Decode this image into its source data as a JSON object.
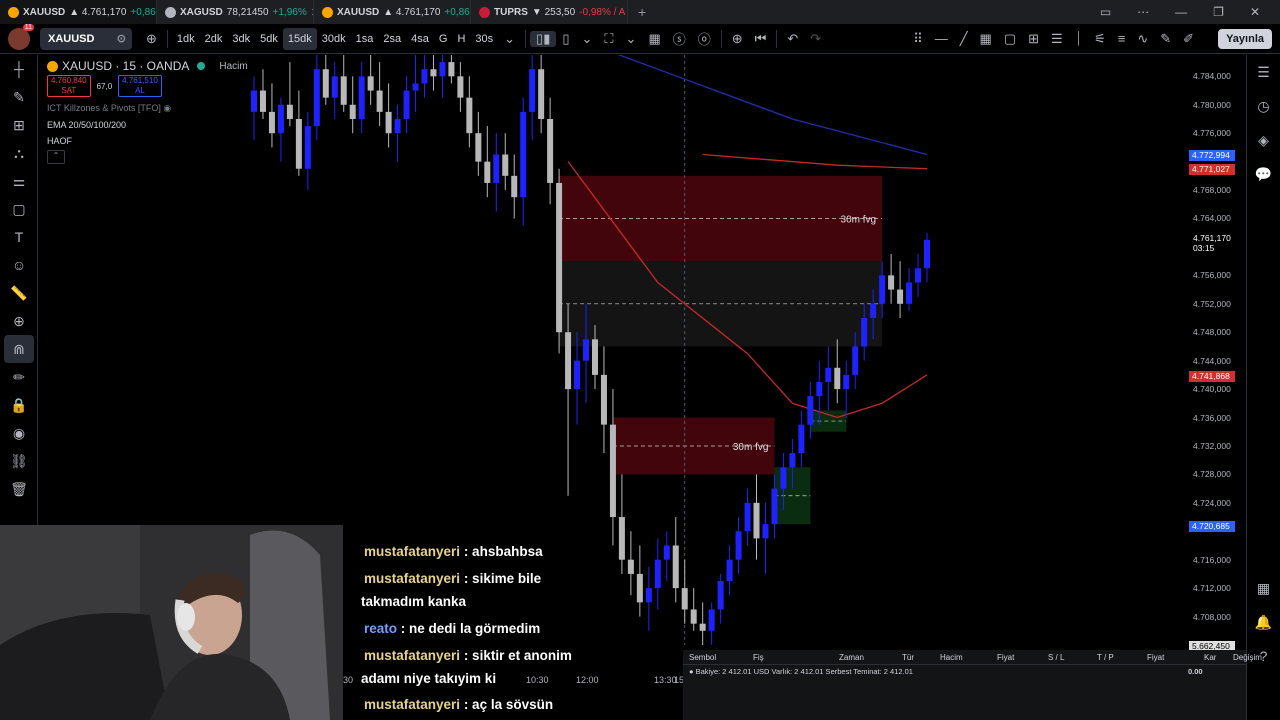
{
  "tabs": [
    {
      "symbol": "XAUUSD",
      "price": "▲ 4.761,170",
      "change": "+0,86%",
      "icon_color": "#f7a600",
      "negative": false,
      "active": true
    },
    {
      "symbol": "XAGUSD",
      "price": "78,21450",
      "change": "+1,96%",
      "icon_color": "#b2b5be",
      "negative": false,
      "active": false
    },
    {
      "symbol": "XAUUSD",
      "price": "▲ 4.761,170",
      "change": "+0,86%",
      "icon_color": "#f7a600",
      "negative": false,
      "active": false
    },
    {
      "symbol": "TUPRS",
      "price": "▼ 253,50",
      "change": "-0,98% / A",
      "icon_color": "#c41e3a",
      "negative": true,
      "active": false
    }
  ],
  "toolbar": {
    "symbol": "XAUUSD",
    "badge": "11",
    "timeframes": [
      "1dk",
      "2dk",
      "3dk",
      "5dk",
      "15dk",
      "30dk",
      "1sa",
      "2sa",
      "4sa",
      "G",
      "H",
      "30s"
    ],
    "selected_timeframe": "15dk",
    "publish_label": "Yayınla"
  },
  "legend": {
    "title": "XAUUSD · 15 · OANDA",
    "volume_label": "Hacim",
    "sell_price": "4.760,840",
    "sell_label": "SAT",
    "spread": "67,0",
    "buy_price": "4.761,510",
    "buy_label": "AL",
    "indicators": [
      "ICT Killzones & Pivots [TFO]",
      "EMA 20/50/100/200",
      "HAOF"
    ]
  },
  "price_axis": {
    "ticks": [
      "4.784,000",
      "4.780,000",
      "4.776,000",
      "4.768,000",
      "4.764,000",
      "4.756,000",
      "4.752,000",
      "4.748,000",
      "4.744,000",
      "4.740,000",
      "4.736,000",
      "4.732,000",
      "4.728,000",
      "4.724,000",
      "4.716,000",
      "4.712,000",
      "4.708,000"
    ],
    "current_price": "4.761,170",
    "countdown": "03:15",
    "tags": [
      {
        "value": "4.772,994",
        "color": "#2962ff"
      },
      {
        "value": "4.771,027",
        "color": "#d32f2f"
      },
      {
        "value": "4.741,868",
        "color": "#d32f2f"
      },
      {
        "value": "4.720,685",
        "color": "#2962ff"
      }
    ],
    "volume_value": "5.662,450"
  },
  "chart_annotations": {
    "fvg_upper": "30m fvg",
    "fvg_lower": "30m fvg"
  },
  "time_axis": [
    "30",
    "10:30",
    "12:00",
    "13:30",
    "15"
  ],
  "panel": {
    "headers": [
      "Sembol",
      "Fiş",
      "Zaman",
      "Tür",
      "Hacim",
      "Fiyat",
      "S / L",
      "T / P",
      "Fiyat",
      "Kar",
      "Değişim"
    ],
    "balance_text": "Bakiye: 2 412.01 USD  Varlık: 2 412.01  Serbest Teminat: 2 412.01",
    "balance_value": "0.00"
  },
  "chat": [
    {
      "user": "mustafatanyeri",
      "text": ": ahsbahbsa"
    },
    {
      "user": "mustafatanyeri",
      "text": ": sikime bile"
    },
    {
      "user": "",
      "text": "takmadım kanka"
    },
    {
      "user": "reato",
      "text": ": ne dedi la görmedim"
    },
    {
      "user": "mustafatanyeri",
      "text": ": siktir et anonim"
    },
    {
      "user": "",
      "text": "adamı niye takıyim ki"
    },
    {
      "user": "mustafatanyeri",
      "text": ": aç la sövsün"
    }
  ],
  "chart_data": {
    "type": "candlestick",
    "title": "XAUUSD · 15 · OANDA",
    "ylim": [
      4704,
      4787
    ],
    "candles": [
      [
        4779,
        4784,
        4775,
        4782
      ],
      [
        4782,
        4785,
        4778,
        4779
      ],
      [
        4779,
        4783,
        4774,
        4776
      ],
      [
        4776,
        4781,
        4772,
        4780
      ],
      [
        4780,
        4786,
        4777,
        4778
      ],
      [
        4778,
        4782,
        4770,
        4771
      ],
      [
        4771,
        4779,
        4768,
        4777
      ],
      [
        4777,
        4787,
        4775,
        4785
      ],
      [
        4785,
        4787,
        4780,
        4781
      ],
      [
        4781,
        4786,
        4778,
        4784
      ],
      [
        4784,
        4787,
        4779,
        4780
      ],
      [
        4780,
        4784,
        4776,
        4778
      ],
      [
        4778,
        4786,
        4776,
        4784
      ],
      [
        4784,
        4787,
        4780,
        4782
      ],
      [
        4782,
        4786,
        4777,
        4779
      ],
      [
        4779,
        4783,
        4774,
        4776
      ],
      [
        4776,
        4780,
        4772,
        4778
      ],
      [
        4778,
        4784,
        4776,
        4782
      ],
      [
        4782,
        4787,
        4779,
        4783
      ],
      [
        4783,
        4787,
        4781,
        4785
      ],
      [
        4785,
        4787,
        4782,
        4784
      ],
      [
        4784,
        4787,
        4781,
        4786
      ],
      [
        4786,
        4787,
        4783,
        4784
      ],
      [
        4784,
        4786,
        4779,
        4781
      ],
      [
        4781,
        4784,
        4774,
        4776
      ],
      [
        4776,
        4779,
        4770,
        4772
      ],
      [
        4772,
        4777,
        4767,
        4769
      ],
      [
        4769,
        4776,
        4765,
        4773
      ],
      [
        4773,
        4776,
        4768,
        4770
      ],
      [
        4770,
        4773,
        4764,
        4767
      ],
      [
        4767,
        4781,
        4763,
        4779
      ],
      [
        4779,
        4787,
        4775,
        4785
      ],
      [
        4785,
        4787,
        4776,
        4778
      ],
      [
        4778,
        4781,
        4766,
        4769
      ],
      [
        4769,
        4771,
        4745,
        4748
      ],
      [
        4748,
        4752,
        4725,
        4740
      ],
      [
        4740,
        4748,
        4735,
        4744
      ],
      [
        4744,
        4752,
        4738,
        4747
      ],
      [
        4747,
        4749,
        4740,
        4742
      ],
      [
        4742,
        4746,
        4731,
        4735
      ],
      [
        4735,
        4740,
        4718,
        4722
      ],
      [
        4722,
        4728,
        4714,
        4716
      ],
      [
        4716,
        4720,
        4711,
        4714
      ],
      [
        4714,
        4718,
        4708,
        4710
      ],
      [
        4710,
        4715,
        4706,
        4712
      ],
      [
        4712,
        4719,
        4709,
        4716
      ],
      [
        4716,
        4720,
        4713,
        4718
      ],
      [
        4718,
        4722,
        4710,
        4712
      ],
      [
        4712,
        4716,
        4707,
        4709
      ],
      [
        4709,
        4712,
        4706,
        4707
      ],
      [
        4707,
        4710,
        4704,
        4706
      ],
      [
        4706,
        4710,
        4704,
        4709
      ],
      [
        4709,
        4714,
        4707,
        4713
      ],
      [
        4713,
        4718,
        4711,
        4716
      ],
      [
        4716,
        4722,
        4714,
        4720
      ],
      [
        4720,
        4726,
        4718,
        4724
      ],
      [
        4724,
        4728,
        4716,
        4719
      ],
      [
        4719,
        4724,
        4714,
        4721
      ],
      [
        4721,
        4728,
        4719,
        4726
      ],
      [
        4726,
        4731,
        4723,
        4729
      ],
      [
        4729,
        4733,
        4726,
        4731
      ],
      [
        4731,
        4737,
        4729,
        4735
      ],
      [
        4735,
        4741,
        4733,
        4739
      ],
      [
        4739,
        4744,
        4735,
        4741
      ],
      [
        4741,
        4746,
        4737,
        4743
      ],
      [
        4743,
        4747,
        4738,
        4740
      ],
      [
        4740,
        4744,
        4736,
        4742
      ],
      [
        4742,
        4748,
        4740,
        4746
      ],
      [
        4746,
        4752,
        4744,
        4750
      ],
      [
        4750,
        4754,
        4747,
        4752
      ],
      [
        4752,
        4758,
        4750,
        4756
      ],
      [
        4756,
        4759,
        4752,
        4754
      ],
      [
        4754,
        4758,
        4750,
        4752
      ],
      [
        4752,
        4757,
        4751,
        4755
      ],
      [
        4755,
        4759,
        4753,
        4757
      ],
      [
        4757,
        4762,
        4755,
        4761
      ]
    ],
    "ema_lines": [
      {
        "name": "EMA 200",
        "color": "#1e2fb0",
        "points": [
          [
            0,
            4795
          ],
          [
            14,
            4793
          ],
          [
            30,
            4792
          ],
          [
            45,
            4785
          ],
          [
            60,
            4778
          ],
          [
            75,
            4773
          ]
        ]
      },
      {
        "name": "EMA 100",
        "color": "#c62828",
        "points": [
          [
            35,
            4772
          ],
          [
            45,
            4755
          ],
          [
            55,
            4745
          ],
          [
            60,
            4738
          ],
          [
            65,
            4736
          ],
          [
            70,
            4738
          ],
          [
            75,
            4742
          ]
        ]
      },
      {
        "name": "EMA 50",
        "color": "#c62828",
        "points": [
          [
            50,
            4773
          ],
          [
            65,
            4771.5
          ],
          [
            75,
            4771
          ]
        ]
      }
    ],
    "zones": [
      {
        "label": "30m fvg",
        "color": "rgba(120,10,20,0.55)",
        "x0": 34,
        "x1": 70,
        "y0": 4770,
        "y1": 4758
      },
      {
        "label": "",
        "color": "rgba(255,255,255,0.08)",
        "x0": 34,
        "x1": 70,
        "y0": 4758,
        "y1": 4746
      },
      {
        "label": "30m fvg",
        "color": "rgba(120,10,20,0.55)",
        "x0": 40,
        "x1": 58,
        "y0": 4736,
        "y1": 4728
      },
      {
        "label": "",
        "color": "rgba(20,100,30,0.45)",
        "x0": 58,
        "x1": 62,
        "y0": 4729,
        "y1": 4721
      },
      {
        "label": "",
        "color": "rgba(20,100,30,0.45)",
        "x0": 62,
        "x1": 66,
        "y0": 4737,
        "y1": 4734
      }
    ]
  }
}
